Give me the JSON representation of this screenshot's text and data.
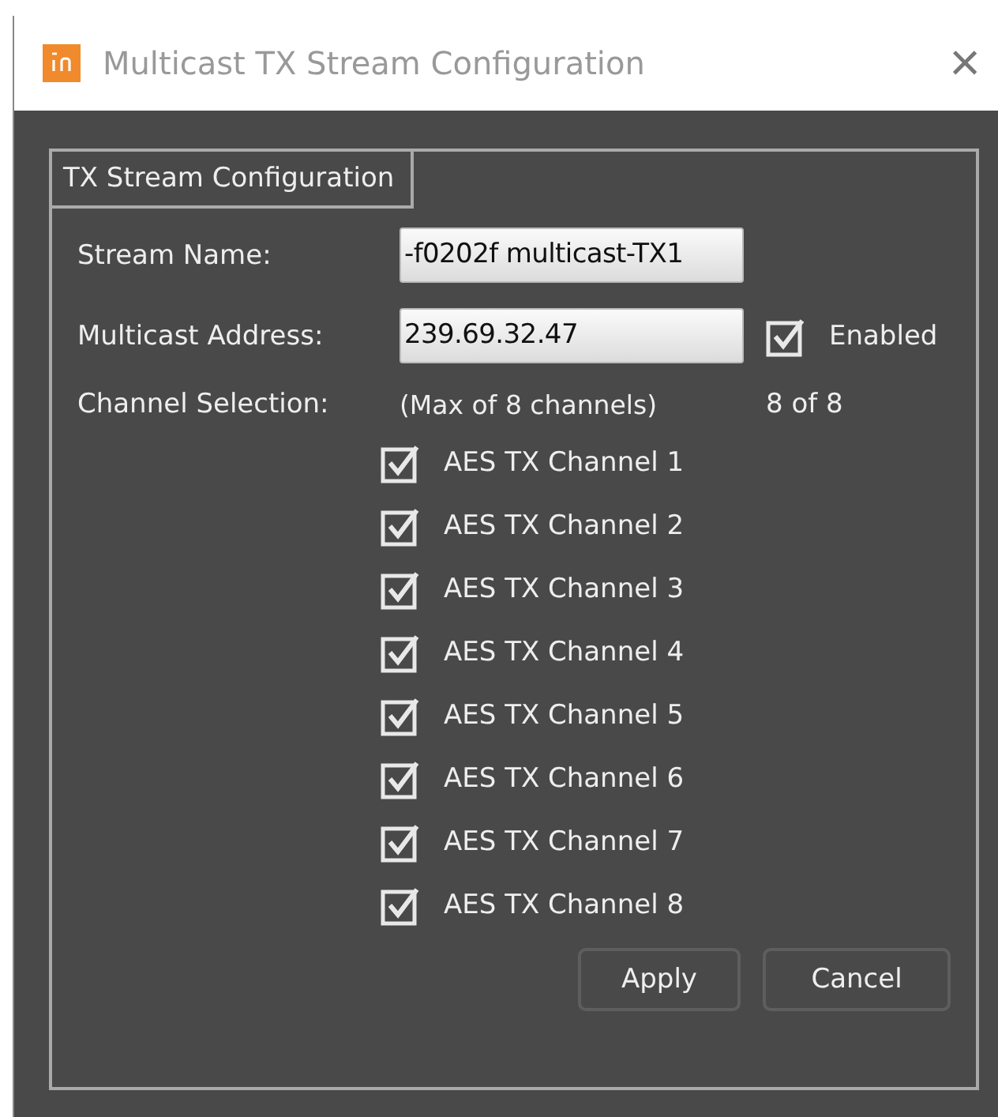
{
  "window": {
    "title": "Multicast TX Stream Configuration",
    "close": "×"
  },
  "group": {
    "tab": "TX Stream Configuration"
  },
  "stream_name": {
    "label": "Stream Name:",
    "value": "-f0202f multicast-TX1"
  },
  "multicast_address": {
    "label": "Multicast Address:",
    "value": "239.69.32.47"
  },
  "enabled": {
    "label": "Enabled",
    "checked": true
  },
  "channel_selection": {
    "label": "Channel Selection:",
    "hint": "(Max of 8 channels)",
    "count": "8 of 8"
  },
  "channels": [
    {
      "label": "AES TX Channel 1",
      "checked": true
    },
    {
      "label": "AES TX Channel 2",
      "checked": true
    },
    {
      "label": "AES TX Channel 3",
      "checked": true
    },
    {
      "label": "AES TX Channel 4",
      "checked": true
    },
    {
      "label": "AES TX Channel 5",
      "checked": true
    },
    {
      "label": "AES TX Channel 6",
      "checked": true
    },
    {
      "label": "AES TX Channel 7",
      "checked": true
    },
    {
      "label": "AES TX Channel 8",
      "checked": true
    }
  ],
  "buttons": [
    "Apply",
    "Cancel"
  ]
}
